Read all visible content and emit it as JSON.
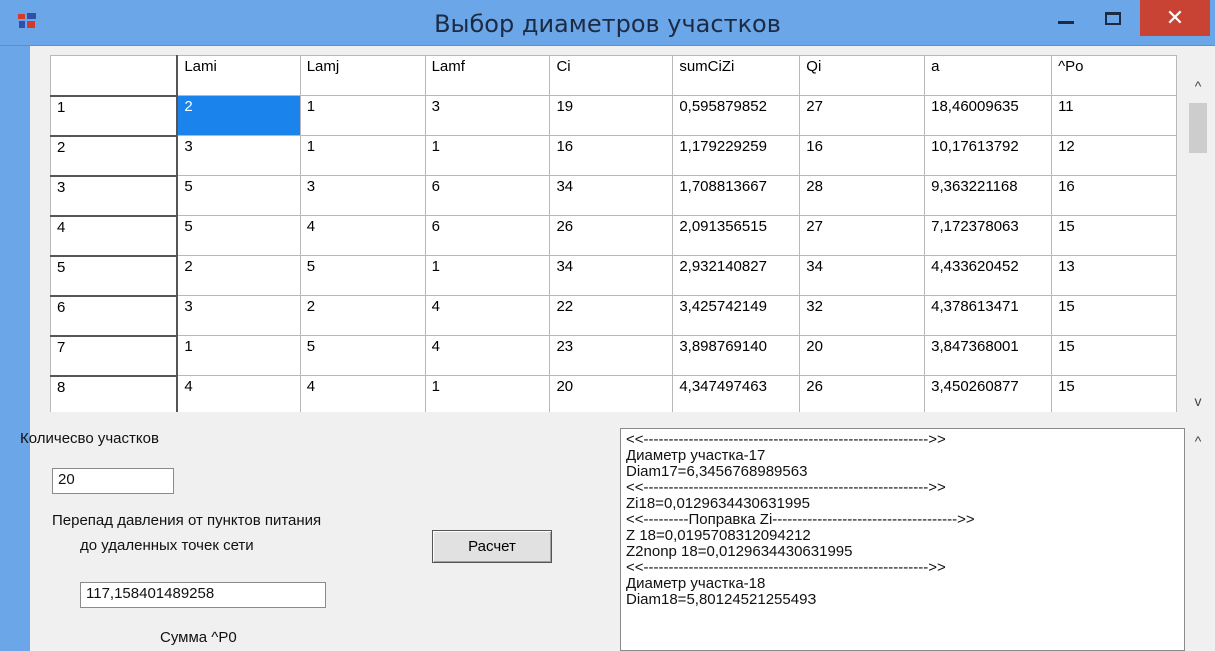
{
  "window": {
    "title": "Выбор диаметров участков",
    "close_glyph": "✕"
  },
  "grid": {
    "columns": [
      "",
      "Lami",
      "Lamj",
      "Lamf",
      "Ci",
      "sumCiZi",
      "Qi",
      "a",
      "^Po"
    ],
    "rows": [
      [
        "1",
        "2",
        "1",
        "3",
        "19",
        "0,595879852",
        "27",
        "18,46009635",
        "11"
      ],
      [
        "2",
        "3",
        "1",
        "1",
        "16",
        "1,179229259",
        "16",
        "10,17613792",
        "12"
      ],
      [
        "3",
        "5",
        "3",
        "6",
        "34",
        "1,708813667",
        "28",
        "9,363221168",
        "16"
      ],
      [
        "4",
        "5",
        "4",
        "6",
        "26",
        "2,091356515",
        "27",
        "7,172378063",
        "15"
      ],
      [
        "5",
        "2",
        "5",
        "1",
        "34",
        "2,932140827",
        "34",
        "4,433620452",
        "13"
      ],
      [
        "6",
        "3",
        "2",
        "4",
        "22",
        "3,425742149",
        "32",
        "4,378613471",
        "15"
      ],
      [
        "7",
        "1",
        "5",
        "4",
        "23",
        "3,898769140",
        "20",
        "3,847368001",
        "15"
      ],
      [
        "8",
        "4",
        "4",
        "1",
        "20",
        "4,347497463",
        "26",
        "3,450260877",
        "15"
      ]
    ],
    "selected": {
      "row": 0,
      "col": 1
    },
    "scroll_up_glyph": "^",
    "scroll_down_glyph": "v"
  },
  "form": {
    "sections_label": "Количесво участков",
    "sections_value": "20",
    "pressure_label_1": "Перепад давления от пунктов питания",
    "pressure_label_2": "до удаленных точек сети",
    "pressure_value": "117,158401489258",
    "calc_button": "Расчет",
    "sum_label": "Сумма ^P0"
  },
  "memo": {
    "lines": [
      "<<--------------------------------------------------------->>",
      "Диаметр участка-17",
      "Diam17=6,3456768989563",
      "<<--------------------------------------------------------->>",
      "Zi18=0,0129634430631995",
      "<<---------Поправка Zi------------------------------------->>",
      "Z 18=0,0195708312094212",
      "Z2nonp 18=0,0129634430631995",
      "<<--------------------------------------------------------->>",
      "Диаметр участка-18",
      "Diam18=5,8012452125549З"
    ],
    "scroll_up_glyph": "^"
  }
}
